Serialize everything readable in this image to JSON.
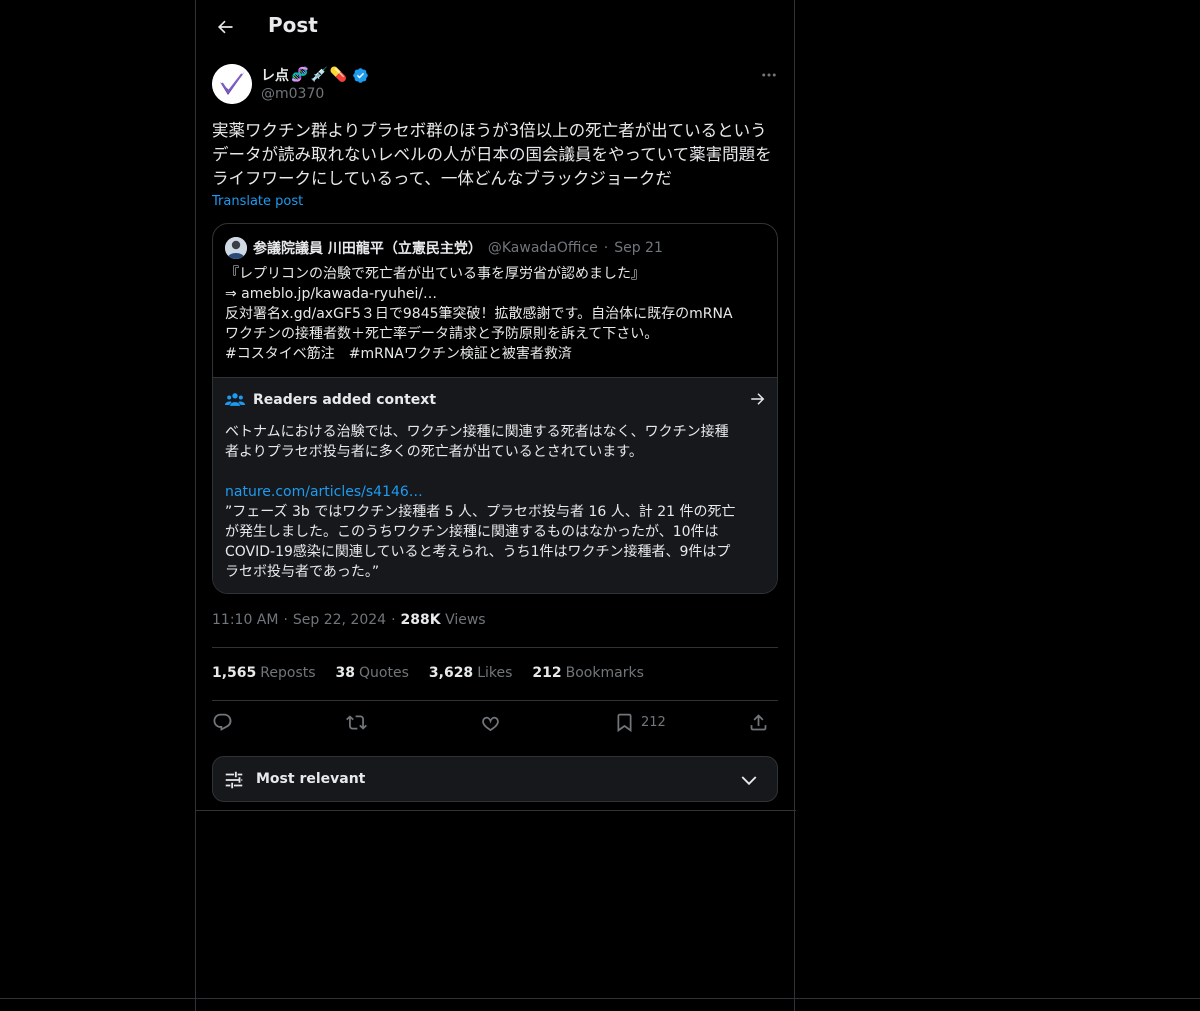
{
  "header": {
    "title": "Post"
  },
  "author": {
    "display_name": "レ点",
    "emojis": [
      "🧬",
      "💉",
      "💊"
    ],
    "handle": "@m0370",
    "verified": true
  },
  "post": {
    "text": "実薬ワクチン群よりプラセボ群のほうが3倍以上の死亡者が出ているというデータが読み取れないレベルの人が日本の国会議員をやっていて薬害問題をライフワークにしているって、一体どんなブラックジョークだ",
    "translate_label": "Translate post"
  },
  "quote": {
    "name": "参議院議員 川田龍平（立憲民主党）",
    "handle": "@KawadaOffice",
    "separator": "·",
    "date": "Sep 21",
    "lines": [
      "『レプリコンの治験で死亡者が出ている事を厚労省が認めました』",
      "⇒ ameblo.jp/kawada-ryuhei/…",
      "反対署名x.gd/axGF5３日で9845筆突破！拡散感謝です。自治体に既存のmRNA",
      "ワクチンの接種者数＋死亡率データ請求と予防原則を訴えて下さい。",
      "#コスタイベ筋注　#mRNAワクチン検証と被害者救済"
    ]
  },
  "context": {
    "title": "Readers added context",
    "line1": "ベトナムにおける治験では、ワクチン接種に関連する死者はなく、ワクチン接種",
    "line2": "者よりプラセボ投与者に多くの死亡者が出ているとされています。",
    "link": "nature.com/articles/s4146…",
    "quote_lines": [
      "”フェーズ 3b ではワクチン接種者 5 人、プラセボ投与者 16 人、計 21 件の死亡",
      "が発生しました。このうちワクチン接種に関連するものはなかったが、10件は",
      "COVID-19感染に関連していると考えられ、うち1件はワクチン接種者、9件はプ",
      "ラセボ投与者であった。”"
    ]
  },
  "meta": {
    "time": "11:10 AM",
    "dot1": "·",
    "date": "Sep 22, 2024",
    "dot2": "·",
    "views_num": "288K",
    "views_label": "Views"
  },
  "stats": {
    "reposts_num": "1,565",
    "reposts_label": "Reposts",
    "quotes_num": "38",
    "quotes_label": "Quotes",
    "likes_num": "3,628",
    "likes_label": "Likes",
    "bookmarks_num": "212",
    "bookmarks_label": "Bookmarks"
  },
  "actions": {
    "bookmark_count": "212"
  },
  "sort": {
    "label": "Most relevant"
  },
  "colors": {
    "accent": "#1d9bf0",
    "border": "#2f3336",
    "muted": "#71767b",
    "text": "#e7e9ea"
  }
}
